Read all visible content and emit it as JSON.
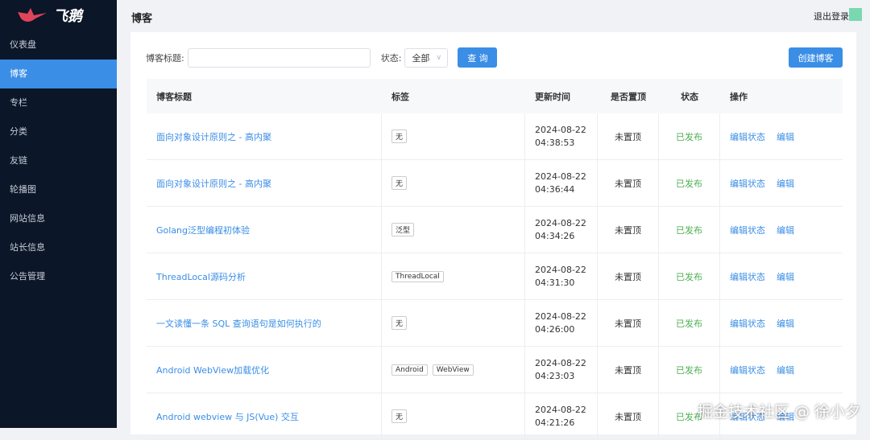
{
  "brand": {
    "name": "飞鹅",
    "logo_color": "#e0445a"
  },
  "sidebar": {
    "items": [
      {
        "label": "仪表盘"
      },
      {
        "label": "博客",
        "active": true
      },
      {
        "label": "专栏"
      },
      {
        "label": "分类"
      },
      {
        "label": "友链"
      },
      {
        "label": "轮播图"
      },
      {
        "label": "网站信息"
      },
      {
        "label": "站长信息"
      },
      {
        "label": "公告管理"
      }
    ]
  },
  "header": {
    "title": "博客",
    "logout": "退出登录"
  },
  "filters": {
    "title_label": "博客标题:",
    "title_value": "",
    "status_label": "状态:",
    "status_value": "全部",
    "query": "查 询",
    "create": "创建博客"
  },
  "table": {
    "columns": [
      "博客标题",
      "标签",
      "更新时间",
      "是否置顶",
      "状态",
      "操作"
    ],
    "rows": [
      {
        "title": "面向对象设计原则之 - 高内聚",
        "tags": [
          "无"
        ],
        "date": "2024-08-22",
        "time": "04:38:53",
        "pinned": "未置顶",
        "status": "已发布"
      },
      {
        "title": "面向对象设计原则之 - 高内聚",
        "tags": [
          "无"
        ],
        "date": "2024-08-22",
        "time": "04:36:44",
        "pinned": "未置顶",
        "status": "已发布"
      },
      {
        "title": "Golang泛型编程初体验",
        "tags": [
          "泛型"
        ],
        "date": "2024-08-22",
        "time": "04:34:26",
        "pinned": "未置顶",
        "status": "已发布"
      },
      {
        "title": "ThreadLocal源码分析",
        "tags": [
          "ThreadLocal"
        ],
        "date": "2024-08-22",
        "time": "04:31:30",
        "pinned": "未置顶",
        "status": "已发布"
      },
      {
        "title": "一文读懂一条 SQL 查询语句是如何执行的",
        "tags": [
          "无"
        ],
        "date": "2024-08-22",
        "time": "04:26:00",
        "pinned": "未置顶",
        "status": "已发布"
      },
      {
        "title": "Android WebView加载优化",
        "tags": [
          "Android",
          "WebView"
        ],
        "date": "2024-08-22",
        "time": "04:23:03",
        "pinned": "未置顶",
        "status": "已发布"
      },
      {
        "title": "Android webview 与 JS(Vue) 交互",
        "tags": [
          "无"
        ],
        "date": "2024-08-22",
        "time": "04:21:26",
        "pinned": "未置顶",
        "status": "已发布"
      }
    ],
    "actions": [
      "编辑状态",
      "编辑"
    ]
  },
  "watermark": "掘金技术社区 @ 徐小夕"
}
